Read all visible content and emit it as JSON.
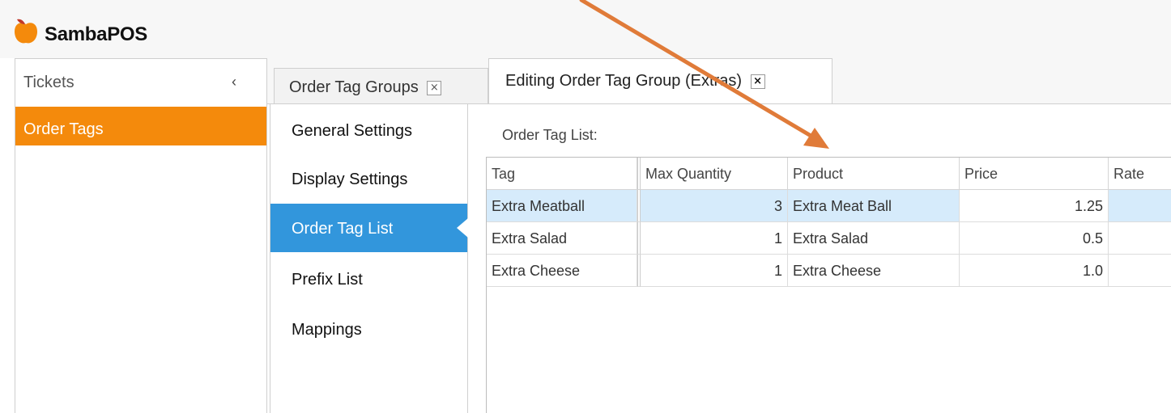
{
  "app": {
    "title": "SambaPOS",
    "logo_icon": "apple-icon",
    "accent_color": "#f48a0c"
  },
  "leftnav": {
    "title": "Tickets",
    "collapse_icon": "chevron-left-icon",
    "items": [
      {
        "label": "Order Tags",
        "selected": true
      }
    ]
  },
  "tabs": [
    {
      "label": "Order Tag Groups",
      "close_icon": "close-icon",
      "active": false
    },
    {
      "label": "Editing Order Tag Group (Extras)",
      "close_icon": "close-icon",
      "active": true
    }
  ],
  "editor": {
    "menu": [
      {
        "label": "General Settings",
        "active": false
      },
      {
        "label": "Display Settings",
        "active": false
      },
      {
        "label": "Order Tag List",
        "active": true
      },
      {
        "label": "Prefix List",
        "active": false
      },
      {
        "label": "Mappings",
        "active": false
      }
    ],
    "active_color": "#3296dc",
    "content_label": "Order Tag List:",
    "grid": {
      "columns": [
        "Tag",
        "Max Quantity",
        "Product",
        "Price",
        "Rate"
      ],
      "rows": [
        {
          "tag": "Extra Meatball",
          "max_quantity": "3",
          "product": "Extra Meat Ball",
          "price": "1.25",
          "rate": "",
          "selected": true
        },
        {
          "tag": "Extra Salad",
          "max_quantity": "1",
          "product": "Extra Salad",
          "price": "0.5",
          "rate": "",
          "selected": false
        },
        {
          "tag": "Extra Cheese",
          "max_quantity": "1",
          "product": "Extra Cheese",
          "price": "1.0",
          "rate": "",
          "selected": false
        }
      ]
    }
  },
  "annotation": {
    "arrow_color": "#e07b39"
  }
}
